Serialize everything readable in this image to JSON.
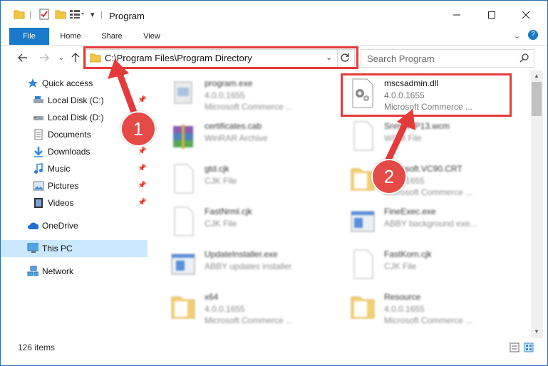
{
  "window": {
    "title": "Program"
  },
  "ribbon": {
    "tabs": [
      "File",
      "Home",
      "Share",
      "View"
    ]
  },
  "address": {
    "path": "C:\\Program Files\\Program Directory"
  },
  "search": {
    "placeholder": "Search Program"
  },
  "sidebar": {
    "items": [
      {
        "label": "Quick access",
        "icon": "star-icon"
      },
      {
        "label": "Local Disk (C:)",
        "icon": "drive-icon",
        "pinned": true
      },
      {
        "label": "Local Disk (D:)",
        "icon": "drive-icon"
      },
      {
        "label": "Documents",
        "icon": "documents-icon"
      },
      {
        "label": "Downloads",
        "icon": "download-icon",
        "pinned": true
      },
      {
        "label": "Music",
        "icon": "music-icon",
        "pinned": true
      },
      {
        "label": "Pictures",
        "icon": "pictures-icon",
        "pinned": true
      },
      {
        "label": "Videos",
        "icon": "video-icon",
        "pinned": true
      },
      {
        "label": "OneDrive",
        "icon": "cloud-icon"
      },
      {
        "label": "This PC",
        "icon": "computer-icon",
        "selected": true
      },
      {
        "label": "Network",
        "icon": "network-icon"
      }
    ]
  },
  "files": [
    {
      "name": "program.exe",
      "line1": "4.0.0.1655",
      "line2": "Microsoft Commerce ..."
    },
    {
      "name": "mscsadmin.dll",
      "line1": "4.0.0.1655",
      "line2": "Microsoft Commerce ..."
    },
    {
      "name": "certificates.cab",
      "line1": "WinRAR Archive",
      "line2": ""
    },
    {
      "name": "SnmpWP13.wcm",
      "line1": "WCM File",
      "line2": ""
    },
    {
      "name": "gtd.cjk",
      "line1": "CJK File",
      "line2": ""
    },
    {
      "name": "Microsoft.VC90.CRT",
      "line1": "4.0.0.1655",
      "line2": "Microsoft Commerce ..."
    },
    {
      "name": "FastNrml.cjk",
      "line1": "CJK File",
      "line2": ""
    },
    {
      "name": "FineExec.exe",
      "line1": "ABBY background exe...",
      "line2": ""
    },
    {
      "name": "UpdateInstaller.exe",
      "line1": "ABBY updates installer",
      "line2": ""
    },
    {
      "name": "FastKorn.cjk",
      "line1": "CJK File",
      "line2": ""
    },
    {
      "name": "x64",
      "line1": "4.0.0.1655",
      "line2": "Microsoft Commerce ..."
    },
    {
      "name": "Resource",
      "line1": "4.0.0.1655",
      "line2": "Microsoft Commerce ..."
    }
  ],
  "status": {
    "count": "126 items"
  },
  "annotations": {
    "step1": "1",
    "step2": "2"
  },
  "colors": {
    "accent": "#1979ca",
    "highlight": "#e53a3a",
    "selected": "#cce8ff"
  }
}
